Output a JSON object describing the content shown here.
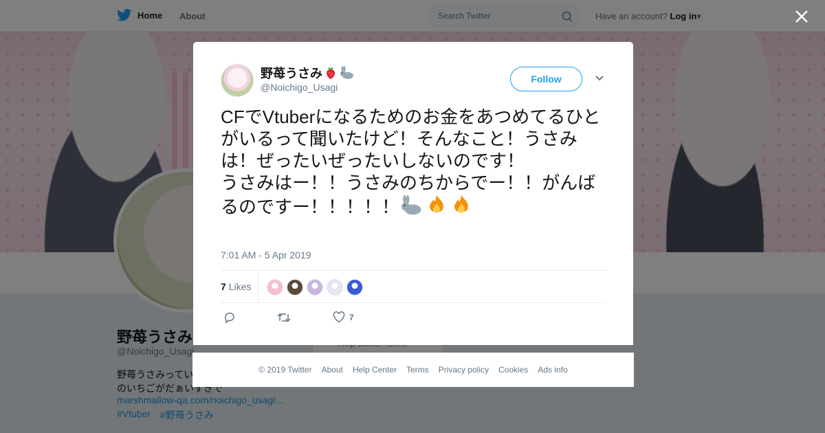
{
  "topbar": {
    "home_label": "Home",
    "about_label": "About",
    "search_placeholder": "Search Twitter",
    "account_prompt": "Have an account?",
    "login_label": "Log in"
  },
  "profile": {
    "name": "野苺うさみ",
    "handle": "@Noichigo_Usagi",
    "bio_line1": "野苺うさみってい",
    "bio_line2": "のいちごがだぁいすきで",
    "link": "marshmallow-qa.com/noichigo_usagi…",
    "tags": [
      "#Vtuber",
      "#野苺うさみ"
    ],
    "help_text": "Help Center    Terms"
  },
  "tweet": {
    "author_name": "野苺うさみ",
    "author_handle": "@Noichigo_Usagi",
    "follow_label": "Follow",
    "text": "CFでVtuberになるためのお金をあつめてるひとがいるって聞いたけど！そんなこと！うさみは！ぜったいぜったいしないのです！\nうさみはー！！うさみのちからでー！！がんばるのですー！！！！！",
    "timestamp": "7:01 AM - 5 Apr 2019",
    "likes_count": "7",
    "likes_label": "Likes",
    "like_action_count": "7"
  },
  "likers": [
    "#f6c1cf",
    "#5a4a3a",
    "#c9b6e0",
    "#e3e6f0",
    "#3b5bd6"
  ],
  "footer": {
    "links": [
      "© 2019 Twitter",
      "About",
      "Help Center",
      "Terms",
      "Privacy policy",
      "Cookies",
      "Ads info"
    ]
  },
  "colors": {
    "accent": "#1da1f2",
    "overlay": "rgba(0,0,0,0.5)"
  }
}
